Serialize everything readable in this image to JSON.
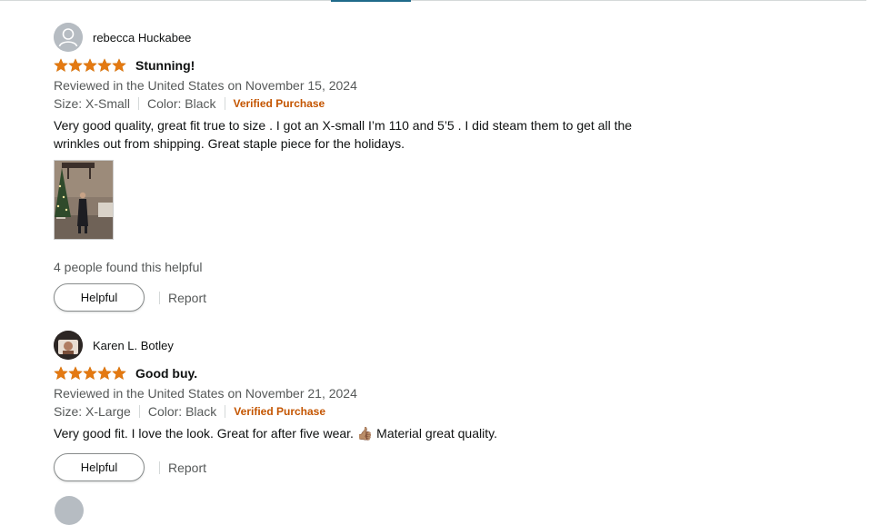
{
  "reviews": [
    {
      "profile_name": "rebecca Huckabee",
      "rating": 5,
      "title": "Stunning!",
      "date": "Reviewed in the United States on November 15, 2024",
      "size": "Size: X-Small",
      "color": "Color: Black",
      "verified": "Verified Purchase",
      "body_line1": "Very good quality, great fit true to size . I got an X-small I’m 110 and 5’5 . I did steam them to get all the",
      "body_line2": "wrinkles out from shipping. Great staple piece for the holidays.",
      "helpful_count": "4 people found this helpful",
      "helpful_label": "Helpful",
      "report_label": "Report"
    },
    {
      "profile_name": "Karen L. Botley",
      "rating": 5,
      "title": "Good buy.",
      "date": "Reviewed in the United States on November 21, 2024",
      "size": "Size: X-Large",
      "color": "Color: Black",
      "verified": "Verified Purchase",
      "body": "Very good fit. I love the look. Great for after five wear. 👍🏽 Material great quality.",
      "helpful_label": "Helpful",
      "report_label": "Report"
    }
  ],
  "colors": {
    "star": "#e47911",
    "verified": "#c45500",
    "muted": "#565959",
    "tab_accent": "#1f6a8a"
  }
}
